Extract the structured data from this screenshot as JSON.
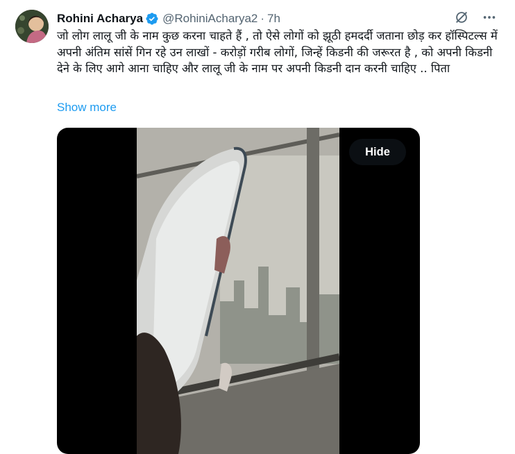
{
  "tweet": {
    "author_name": "Rohini Acharya",
    "handle": "@RohiniAcharya2",
    "separator": "·",
    "time": "7h",
    "text": "जो लोग लालू जी के नाम कुछ करना चाहते हैं , तो ऐसे लोगों को झूठी हमदर्दी जताना छोड़ कर हॉस्पिटल्स में अपनी अंतिम सांसें गिन रहे उन लाखों - करोड़ों गरीब लोगों, जिन्हें किडनी की जरूरत है , को अपनी किडनी देने के लिए आगे आना चाहिए और लालू जी के नाम पर अपनी किडनी दान करनी चाहिए .. पिता",
    "show_more": "Show more",
    "hide_label": "Hide"
  },
  "icons": {
    "verified": "verified-badge-icon",
    "grok": "grok-icon",
    "more": "more-icon"
  },
  "colors": {
    "link": "#1d9bf0",
    "verified": "#1d9bf0",
    "muted": "#536471"
  }
}
